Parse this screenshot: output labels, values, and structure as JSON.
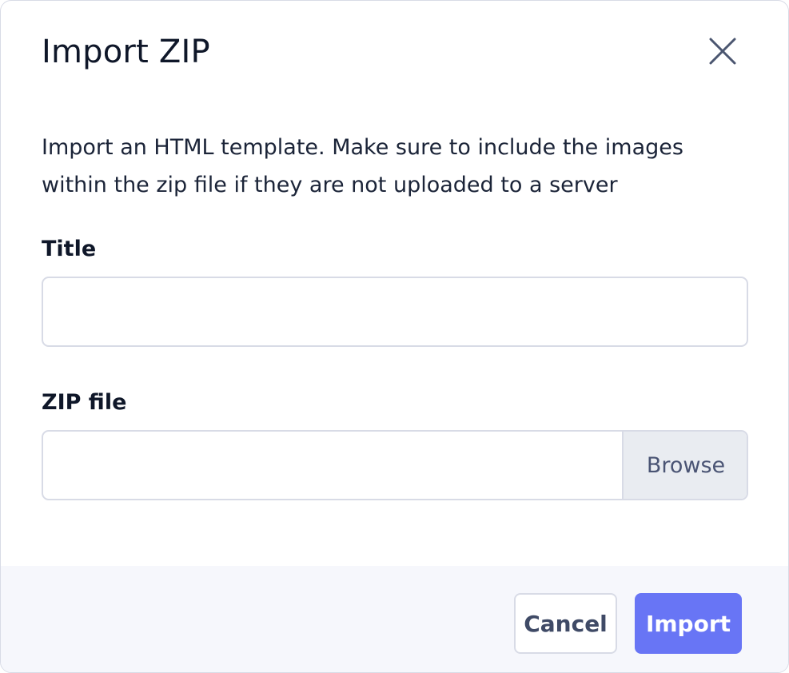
{
  "dialog": {
    "title": "Import ZIP",
    "description": "Import an HTML template. Make sure to include the images within the zip file if they are not uploaded to a server"
  },
  "form": {
    "title_label": "Title",
    "title_value": "",
    "zip_label": "ZIP file",
    "zip_value": "",
    "browse_label": "Browse"
  },
  "footer": {
    "cancel_label": "Cancel",
    "import_label": "Import"
  },
  "colors": {
    "accent": "#6875f5",
    "border": "#d8dbe6",
    "footer_bg": "#f6f7fc",
    "browse_bg": "#e9ecf1"
  },
  "icons": {
    "close": "close-icon"
  }
}
